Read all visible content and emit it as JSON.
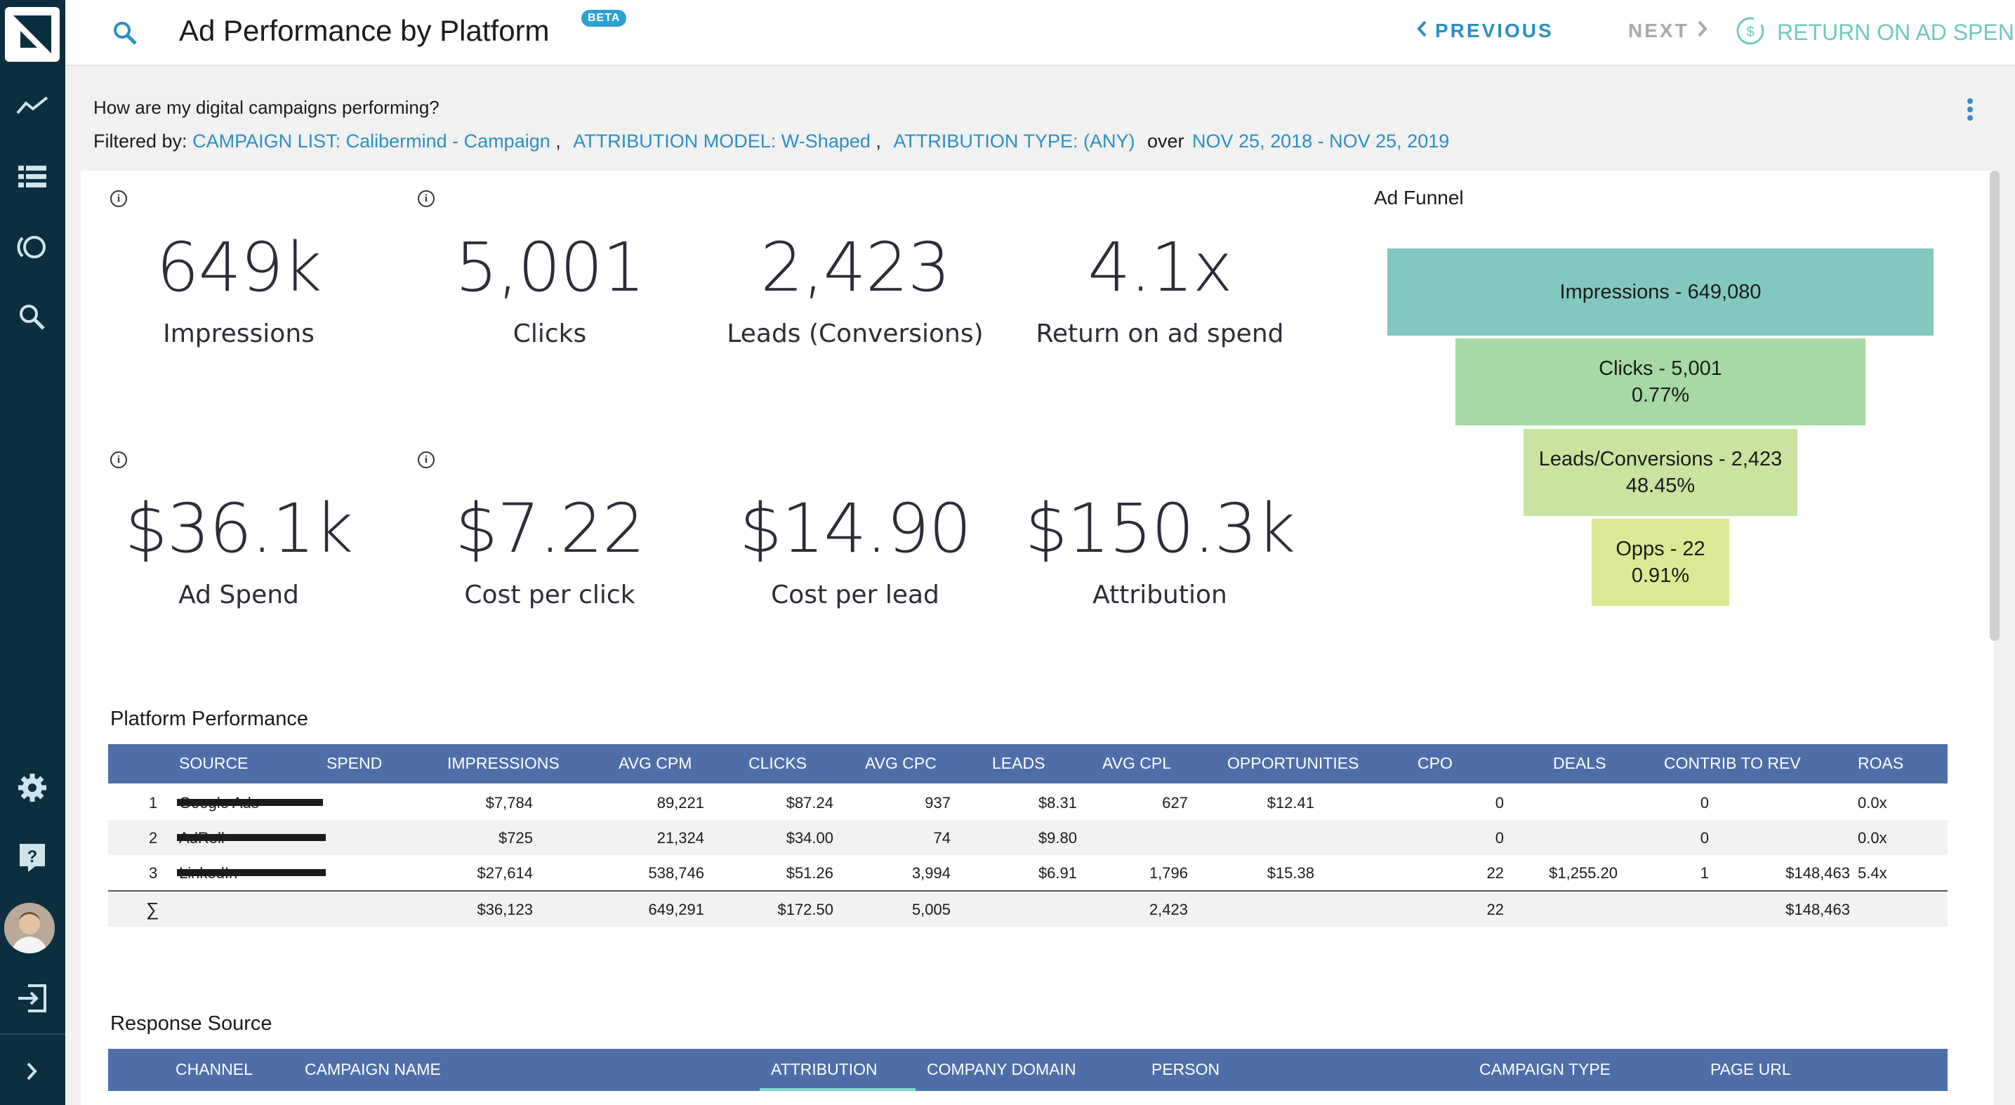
{
  "header": {
    "title": "Ad Performance by Platform",
    "badge": "BETA",
    "prev": "PREVIOUS",
    "next": "NEXT",
    "kpi": "RETURN ON AD SPEND"
  },
  "question": "How are my digital campaigns performing?",
  "filters": {
    "prefix": "Filtered by:",
    "campaign_list": "CAMPAIGN LIST: Calibermind - Campaign",
    "attribution_model": "ATTRIBUTION MODEL: W-Shaped",
    "attribution_type": "ATTRIBUTION TYPE: (ANY)",
    "over": "over",
    "date_range": "NOV 25, 2018 - NOV 25, 2019"
  },
  "metrics": [
    {
      "value": "649k",
      "label": "Impressions"
    },
    {
      "value": "5,001",
      "label": "Clicks"
    },
    {
      "value": "2,423",
      "label": "Leads (Conversions)"
    },
    {
      "value": "4.1x",
      "label": "Return on ad spend"
    },
    {
      "value": "$36.1k",
      "label": "Ad Spend"
    },
    {
      "value": "$7.22",
      "label": "Cost per click"
    },
    {
      "value": "$14.90",
      "label": "Cost per lead"
    },
    {
      "value": "$150.3k",
      "label": "Attribution"
    }
  ],
  "funnel": {
    "title": "Ad Funnel",
    "stages": [
      {
        "line1": "Impressions - 649,080",
        "line2": "",
        "color": "#82c8c1"
      },
      {
        "line1": "Clicks - 5,001",
        "line2": "0.77%",
        "color": "#a6d9a5"
      },
      {
        "line1": "Leads/Conversions - 2,423",
        "line2": "48.45%",
        "color": "#c9e3a0"
      },
      {
        "line1": "Opps - 22",
        "line2": "0.91%",
        "color": "#dde894"
      }
    ]
  },
  "platform_table": {
    "title": "Platform Performance",
    "columns": [
      "SOURCE",
      "SPEND",
      "IMPRESSIONS",
      "AVG CPM",
      "CLICKS",
      "AVG CPC",
      "LEADS",
      "AVG CPL",
      "OPPORTUNITIES",
      "CPO",
      "DEALS",
      "CONTRIB TO REV",
      "ROAS"
    ],
    "rows": [
      {
        "idx": "1",
        "source": "Google Ads",
        "spend": "$7,784",
        "impressions": "89,221",
        "cpm": "$87.24",
        "clicks": "937",
        "cpc": "$8.31",
        "leads": "627",
        "cpl": "$12.41",
        "opps": "0",
        "cpo": "",
        "deals": "0",
        "contrib": "",
        "roas": "0.0x"
      },
      {
        "idx": "2",
        "source": "AdRoll",
        "spend": "$725",
        "impressions": "21,324",
        "cpm": "$34.00",
        "clicks": "74",
        "cpc": "$9.80",
        "leads": "",
        "cpl": "",
        "opps": "0",
        "cpo": "",
        "deals": "0",
        "contrib": "",
        "roas": "0.0x"
      },
      {
        "idx": "3",
        "source": "LinkedIn",
        "spend": "$27,614",
        "impressions": "538,746",
        "cpm": "$51.26",
        "clicks": "3,994",
        "cpc": "$6.91",
        "leads": "1,796",
        "cpl": "$15.38",
        "opps": "22",
        "cpo": "$1,255.20",
        "deals": "1",
        "contrib": "$148,463",
        "roas": "5.4x"
      }
    ],
    "total": {
      "idx": "∑",
      "spend": "$36,123",
      "impressions": "649,291",
      "cpm": "$172.50",
      "clicks": "5,005",
      "leads": "2,423",
      "opps": "22",
      "contrib": "$148,463"
    }
  },
  "response_table": {
    "title": "Response Source",
    "columns": [
      "CHANNEL",
      "CAMPAIGN NAME",
      "ATTRIBUTION",
      "COMPANY DOMAIN",
      "PERSON",
      "CAMPAIGN TYPE",
      "PAGE URL"
    ]
  },
  "sidebar": {
    "icons": [
      "logo-icon",
      "trend-icon",
      "list-icon",
      "orbit-icon",
      "search-icon",
      "gear-icon",
      "help-icon",
      "avatar",
      "logout-icon",
      "expand-icon"
    ]
  },
  "colors": {
    "sidebar": "#0b2f3f",
    "accent": "#2a8fc4",
    "kpi": "#6dc9c0",
    "table_header": "#4f6ea8"
  }
}
